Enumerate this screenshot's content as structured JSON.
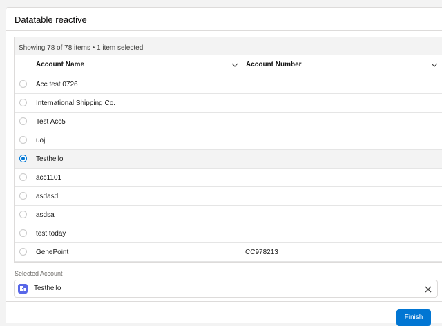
{
  "card": {
    "title": "Datatable reactive"
  },
  "table": {
    "info": "Showing 78 of 78 items • 1 item selected",
    "columns": [
      {
        "label": "Account Name",
        "icon": "chevron-down-icon"
      },
      {
        "label": "Account Number",
        "icon": "chevron-down-icon"
      }
    ],
    "rows": [
      {
        "name": "Acc test 0726",
        "number": "",
        "selected": false
      },
      {
        "name": "International Shipping Co.",
        "number": "",
        "selected": false
      },
      {
        "name": "Test Acc5",
        "number": "",
        "selected": false
      },
      {
        "name": "uojl",
        "number": "",
        "selected": false
      },
      {
        "name": "Testhello",
        "number": "",
        "selected": true
      },
      {
        "name": "acc1101",
        "number": "",
        "selected": false
      },
      {
        "name": "asdasd",
        "number": "",
        "selected": false
      },
      {
        "name": "asdsa",
        "number": "",
        "selected": false
      },
      {
        "name": "test today",
        "number": "",
        "selected": false
      },
      {
        "name": "GenePoint",
        "number": "CC978213",
        "selected": false
      }
    ]
  },
  "selected_account": {
    "label": "Selected Account",
    "value": "Testhello",
    "icon": "account-icon",
    "clear_icon": "close-icon"
  },
  "footer": {
    "finish_label": "Finish"
  },
  "colors": {
    "brand": "#0176d3",
    "account_icon": "#5867e8"
  }
}
